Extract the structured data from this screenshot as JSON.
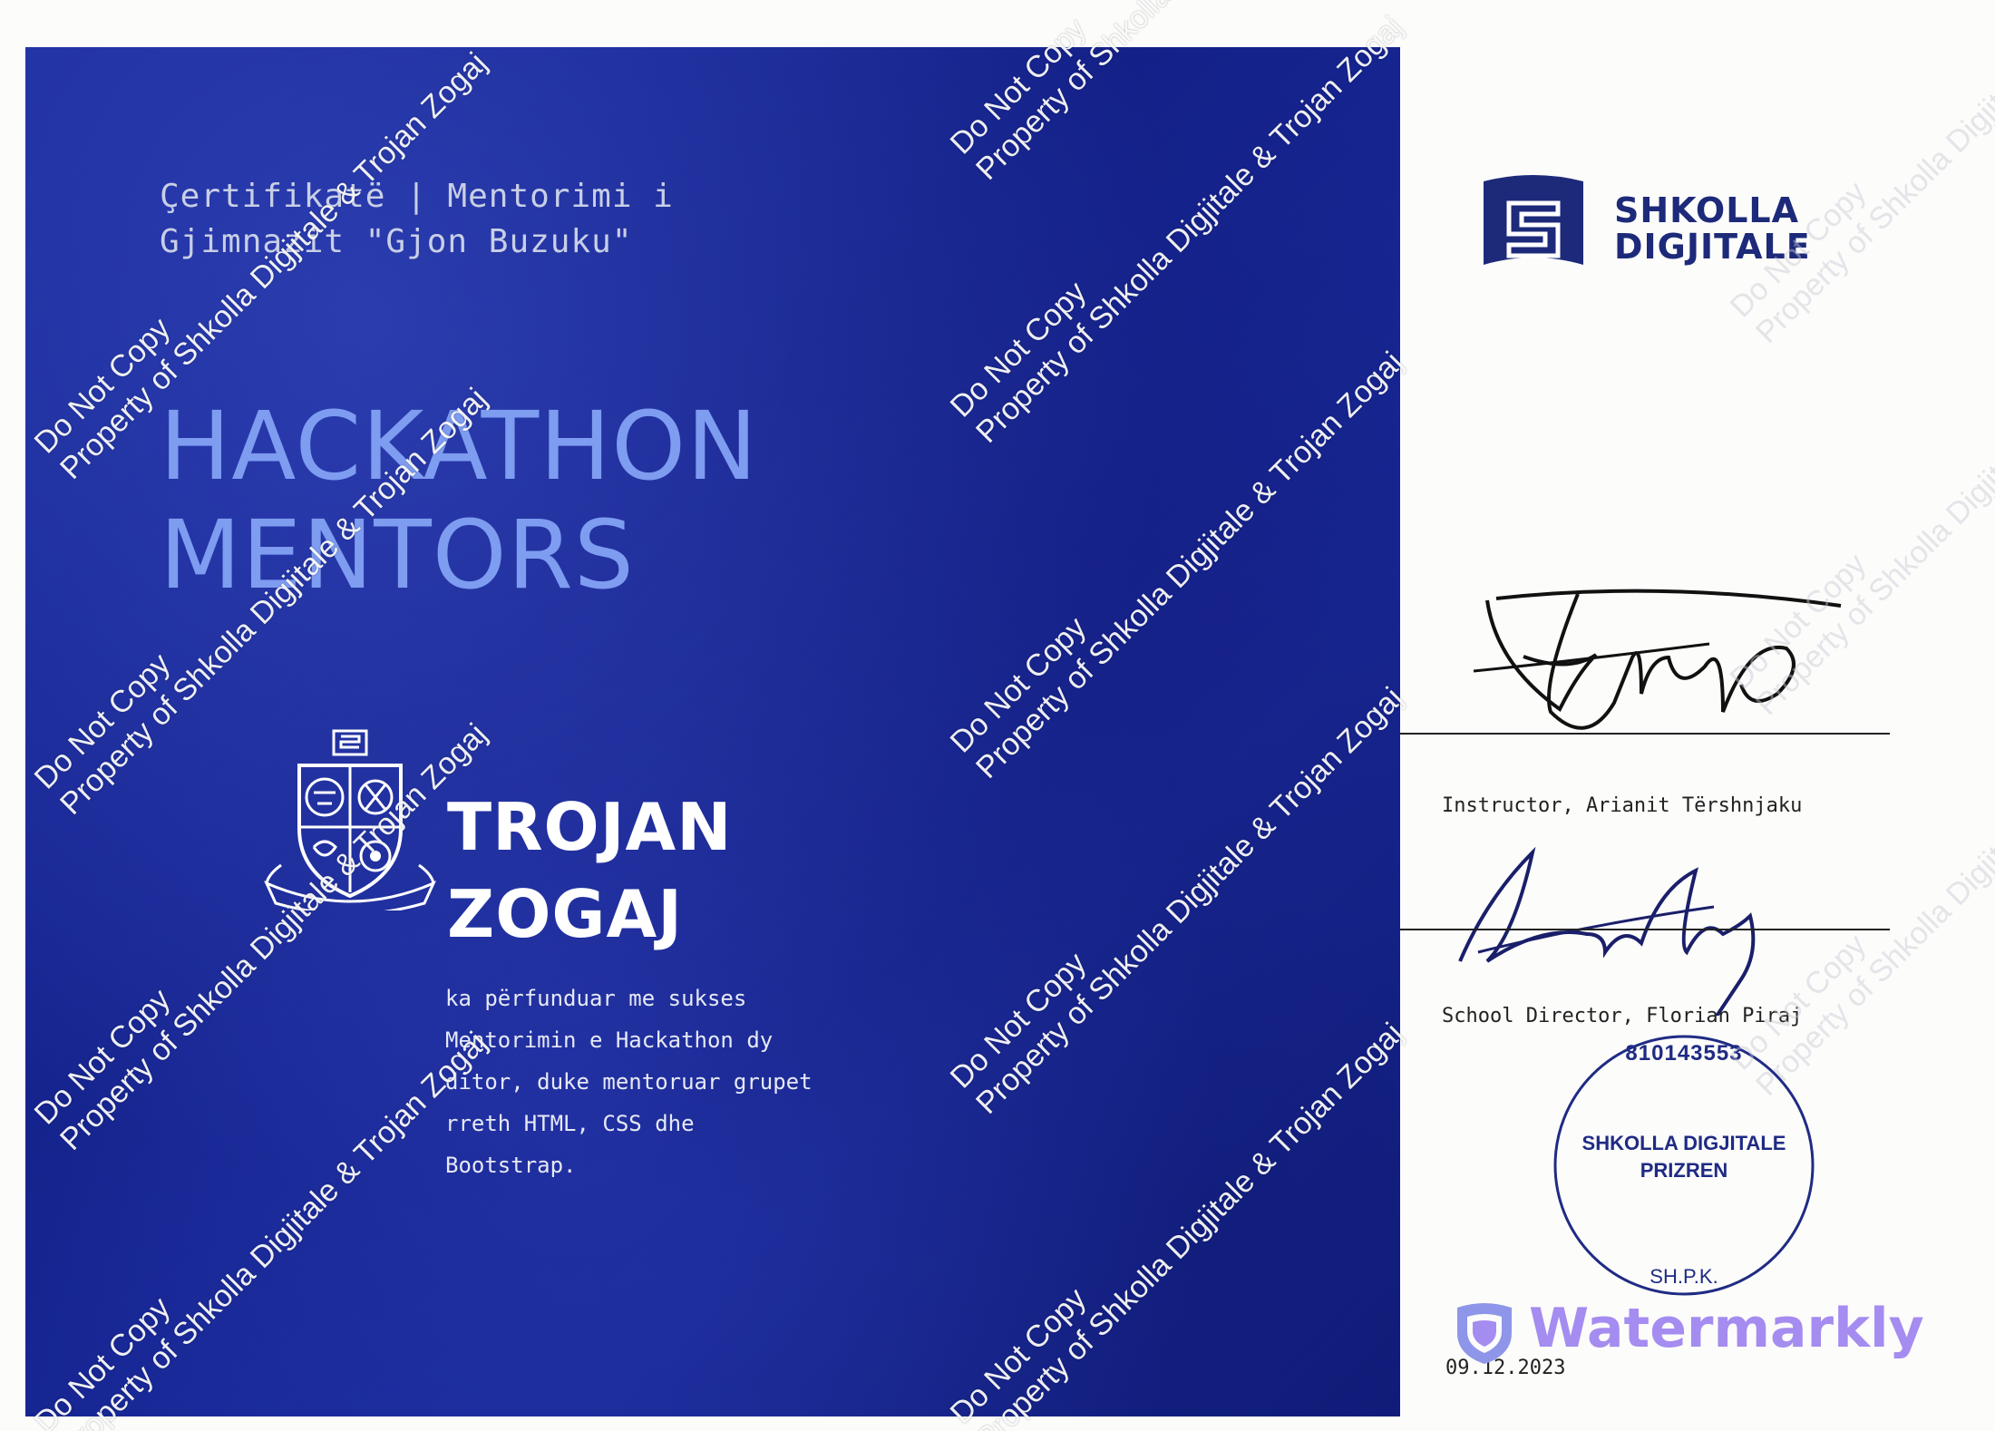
{
  "certificate": {
    "title_line1": "Çertifikatë | Mentorimi i",
    "title_line2": "Gjimnazit \"Gjon Buzuku\"",
    "headline_line1": "HACKATHON",
    "headline_line2": "MENTORS",
    "recipient_first": "TROJAN",
    "recipient_last": "ZOGAJ",
    "description_lines": [
      "ka përfunduar me sukses",
      "Mentorimin e  Hackathon dy",
      "ditor, duke mentoruar grupet",
      "rreth HTML, CSS dhe",
      "Bootstrap."
    ]
  },
  "logo": {
    "line1": "SHKOLLA",
    "line2": "DIGJITALE"
  },
  "signatures": {
    "instructor_caption": "Instructor, Arianit Tërshnjaku",
    "director_caption": "School Director, Florian Piraj"
  },
  "stamp": {
    "number": "810143553",
    "line1": "SHKOLLA DIGJITALE",
    "line2": "PRIZREN",
    "bottom": "SH.P.K."
  },
  "date": "09.12.2023",
  "watermark": {
    "line1": "Do Not Copy",
    "line2": "Property of Shkolla Digjitale & Trojan Zogaj",
    "badge": "Watermarkly"
  },
  "colors": {
    "panel_blue": "#13218a",
    "headline": "#7e9cf0",
    "logo_navy": "#1d2a7a",
    "badge_purple": "#a58cf0"
  }
}
